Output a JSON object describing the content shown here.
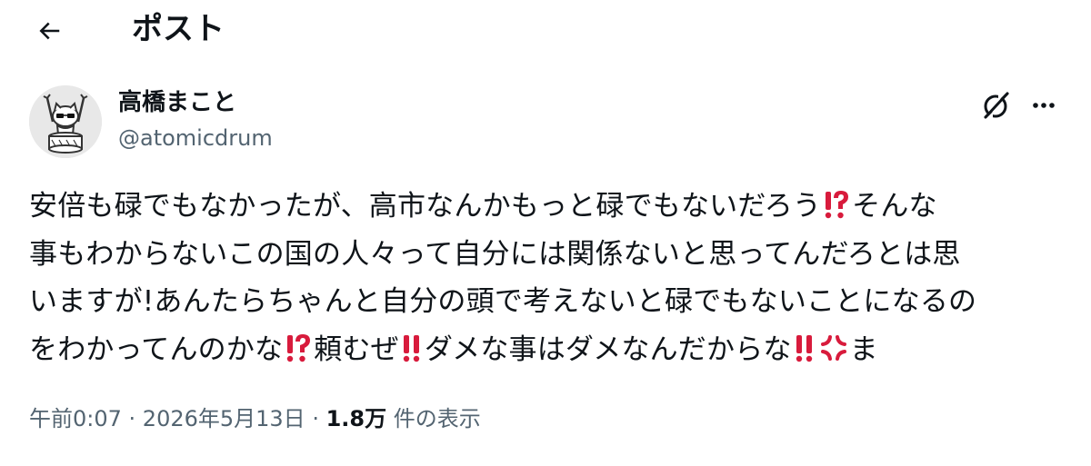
{
  "header": {
    "title": "ポスト"
  },
  "author": {
    "display_name": "高橋まこと",
    "handle": "@atomicdrum"
  },
  "post": {
    "lines": [
      [
        "安倍も碌でもなかったが、高市なんかもっと碌でもないだろう",
        "⁉",
        "そんな"
      ],
      [
        "事もわからないこの国の人々って自分には関係ないと思ってんだろとは思"
      ],
      [
        "いますが!あんたらちゃんと自分の頭で考えないと碌でもないことになるの"
      ],
      [
        "をわかってんのかな",
        "⁉",
        "頼むぜ",
        "‼",
        "ダメな事はダメなんだからな",
        "‼",
        "💢",
        "ま"
      ]
    ]
  },
  "meta": {
    "time": "午前0:07",
    "sep1": " · ",
    "date": "2026年5月13日",
    "sep2": " · ",
    "views_count": "1.8万",
    "views_label": " 件の表示"
  },
  "icons": {
    "back": "arrow-left-icon",
    "grok": "grok-icon",
    "more": "more-horizontal-icon",
    "interrobang": "exclamation-question-mark-emoji",
    "double_exclamation": "double-exclamation-mark-emoji",
    "anger": "anger-symbol-emoji"
  },
  "colors": {
    "text": "#0f1419",
    "secondary": "#536471",
    "emoji_red": "#d81b3c"
  }
}
